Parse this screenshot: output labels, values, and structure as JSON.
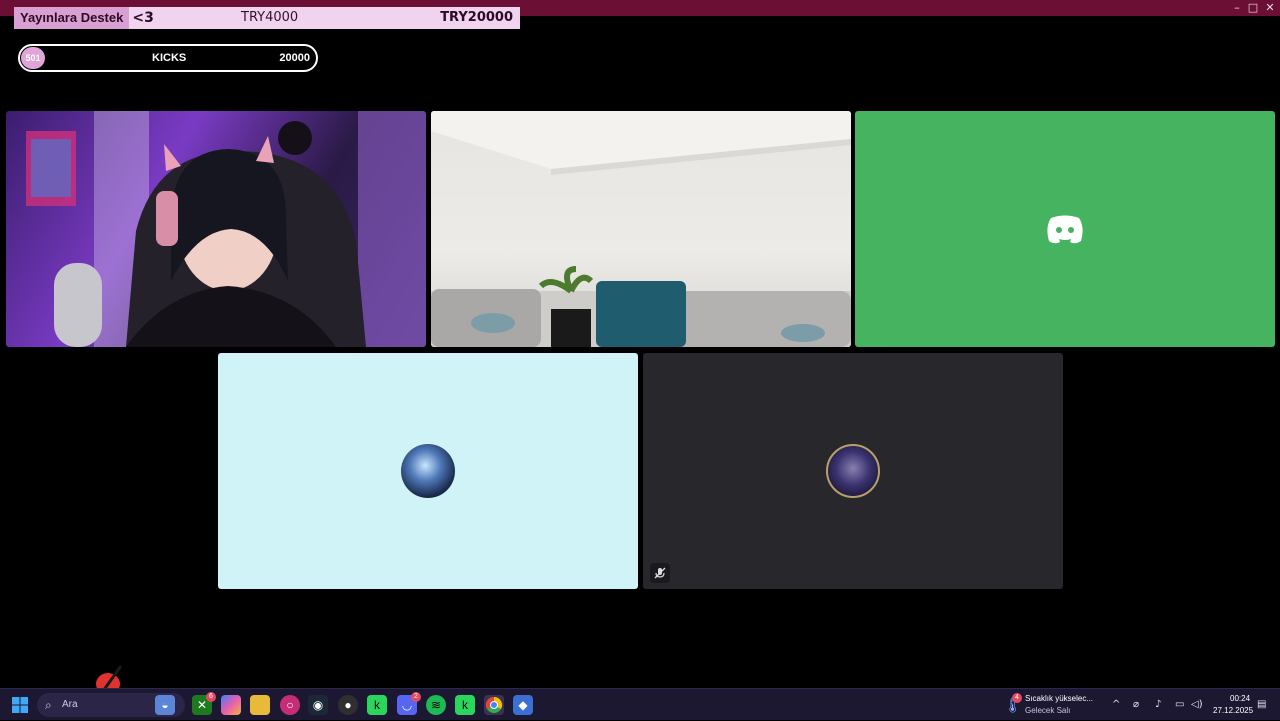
{
  "window": {
    "minimize_glyph": "–",
    "maximize_glyph": "□",
    "close_glyph": "✕"
  },
  "donation": {
    "title": "Yayınlara Destek",
    "heart": "<3",
    "current": "TRY4000",
    "goal": "TRY20000",
    "progress": 0.2
  },
  "kicks": {
    "count": "501",
    "label": "KICKS",
    "goal": "20000"
  },
  "tiles": {
    "discord_icon": "discord-logo",
    "mute_icon": "microphone-muted-icon"
  },
  "taskbar": {
    "search_placeholder": "Ara",
    "apps": [
      {
        "name": "rocket-app-icon",
        "badge": ""
      },
      {
        "name": "xbox-icon",
        "badge": "6"
      },
      {
        "name": "copilot-icon",
        "badge": ""
      },
      {
        "name": "file-explorer-icon",
        "badge": ""
      },
      {
        "name": "osu-icon",
        "badge": ""
      },
      {
        "name": "steam-icon",
        "badge": ""
      },
      {
        "name": "obs-icon",
        "badge": ""
      },
      {
        "name": "kick-app-icon",
        "badge": ""
      },
      {
        "name": "discord-icon",
        "badge": "2"
      },
      {
        "name": "spotify-icon",
        "badge": ""
      },
      {
        "name": "kick-app-2-icon",
        "badge": ""
      },
      {
        "name": "chrome-icon",
        "badge": ""
      },
      {
        "name": "game-app-icon",
        "badge": ""
      }
    ],
    "weather": {
      "badge": "4",
      "line1": "Sıcaklık yükselec...",
      "line2": "Gelecek Salı"
    },
    "clock": {
      "time": "00:24",
      "date": "27.12.2025"
    }
  },
  "colors": {
    "titlebar": "#6b0f35",
    "discord_green": "#45b35f",
    "light_tile": "#d0f3f7",
    "dark_tile": "#28272c",
    "taskbar": "#1d1832"
  }
}
